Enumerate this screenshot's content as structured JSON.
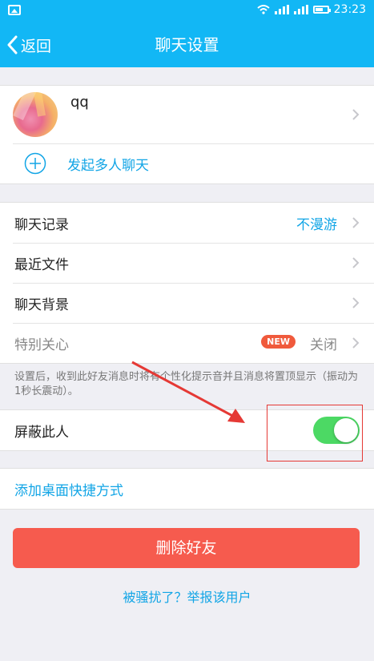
{
  "status_bar": {
    "time": "23:23"
  },
  "nav": {
    "back_label": "返回",
    "title": "聊天设置"
  },
  "profile": {
    "name": "qq",
    "multi_chat_label": "发起多人聊天"
  },
  "settings": {
    "chat_history": {
      "label": "聊天记录",
      "value": "不漫游"
    },
    "recent_files": {
      "label": "最近文件"
    },
    "chat_background": {
      "label": "聊天背景"
    },
    "special_care": {
      "label": "特别关心",
      "badge": "NEW",
      "value": "关闭"
    },
    "special_care_hint": "设置后，收到此好友消息时将有个性化提示音并且消息将置顶显示（振动为1秒长震动）。",
    "block": {
      "label": "屏蔽此人",
      "enabled": true
    },
    "shortcut": {
      "label": "添加桌面快捷方式"
    }
  },
  "actions": {
    "delete_label": "删除好友",
    "report_label": "被骚扰了？举报该用户"
  },
  "colors": {
    "accent": "#12b7f5",
    "link": "#12a5e6",
    "danger": "#f65b4e",
    "switch_on": "#4cd964",
    "annotation": "#e53935"
  }
}
